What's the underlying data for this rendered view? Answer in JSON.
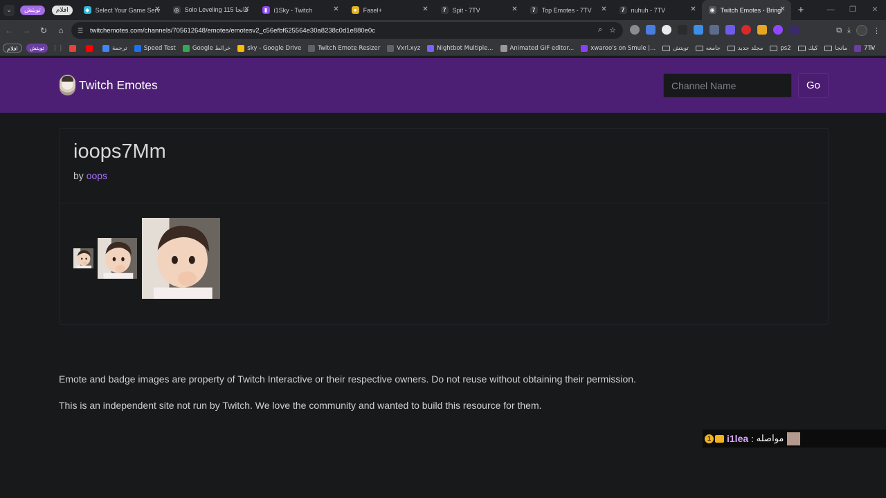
{
  "browser": {
    "tab_groups": [
      "تويتش",
      "افلام"
    ],
    "tabs": [
      {
        "title": "Select Your Game Serv",
        "fav_color": "#2fb9d8",
        "fav_glyph": "◆"
      },
      {
        "title": "Solo Leveling 115 مانجا",
        "fav_color": "#3a3b3f",
        "fav_glyph": "◎"
      },
      {
        "title": "i1Sky - Twitch",
        "fav_color": "#9146ff",
        "fav_glyph": "▮"
      },
      {
        "title": "Fasel+",
        "fav_color": "#e6b422",
        "fav_glyph": "●"
      },
      {
        "title": "Spit - 7TV",
        "fav_color": "#35363a",
        "fav_glyph": "7"
      },
      {
        "title": "Top Emotes - 7TV",
        "fav_color": "#35363a",
        "fav_glyph": "7"
      },
      {
        "title": "nuhuh - 7TV",
        "fav_color": "#35363a",
        "fav_glyph": "7"
      },
      {
        "title": "Twitch Emotes - Bringi",
        "fav_color": "#55575c",
        "fav_glyph": "◉",
        "active": true
      }
    ],
    "url": "twitchemotes.com/channels/705612648/emotes/emotesv2_c56efbf625564e30a8238c0d1e880e0c",
    "bookmarks": [
      {
        "label": "",
        "color": "#ea4335"
      },
      {
        "label": "",
        "color": "#ff0000"
      },
      {
        "label": "ترجمة",
        "color": "#4285f4"
      },
      {
        "label": "Speed Test",
        "color": "#1a73e8"
      },
      {
        "label": "Google خرائط",
        "color": "#34a853"
      },
      {
        "label": "sky - Google Drive",
        "color": "#fbbc04"
      },
      {
        "label": "Twitch Emote Resizer",
        "color": "#5f6368"
      },
      {
        "label": "Vxrl.xyz",
        "color": "#5f6368"
      },
      {
        "label": "Nightbot Multiple...",
        "color": "#7b61ff"
      },
      {
        "label": "Animated GIF editor...",
        "color": "#999999"
      },
      {
        "label": "xwaroo's on Smule |...",
        "color": "#8a3ffc"
      }
    ],
    "bookmark_folders": [
      "تويتش",
      "جامعه",
      "مجلد جديد",
      "ps2",
      "كيك",
      "مانجا"
    ],
    "bookmark_tail": "7TV",
    "bookmark_pills": [
      "افلام",
      "تويتش"
    ]
  },
  "site": {
    "brand": "Twitch Emotes",
    "search": {
      "placeholder": "Channel Name",
      "button": "Go"
    },
    "emote": {
      "name": "ioops7Mm",
      "by_label": "by",
      "owner": "oops"
    },
    "footer": [
      "Emote and badge images are property of Twitch Interactive or their respective owners. Do not reuse without obtaining their permission.",
      "This is an independent site not run by Twitch. We love the community and wanted to build this resource for them."
    ]
  },
  "overlay": {
    "badge": "1",
    "user": "i1lea",
    "sep": ":",
    "message": "مواصله"
  }
}
